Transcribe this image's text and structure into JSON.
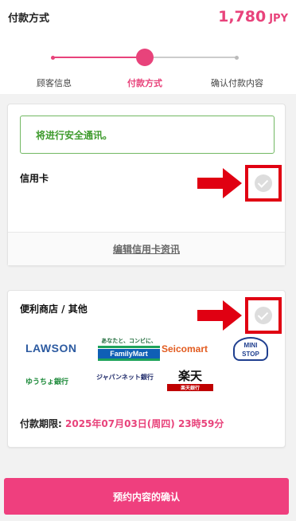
{
  "header": {
    "title": "付款方式",
    "amount": "1,780",
    "currency": "JPY"
  },
  "steps": [
    {
      "label": "顾客信息",
      "state": "done"
    },
    {
      "label": "付款方式",
      "state": "active"
    },
    {
      "label": "确认付款内容",
      "state": "pending"
    }
  ],
  "credit_card": {
    "secure_notice": "将进行安全通讯。",
    "title": "信用卡",
    "edit_link": "编辑信用卡资讯",
    "icon": "check-circle-icon"
  },
  "convenience": {
    "title": "便利商店 / 其他",
    "icon": "check-circle-icon",
    "logos": {
      "lawson": "LAWSON",
      "familymart_tagline": "あなたと、コンビに、",
      "familymart": "FamilyMart",
      "seicomart": "Seicomart",
      "ministop_line1": "MINI",
      "ministop_line2": "STOP",
      "yucho": "ゆうちょ銀行",
      "japannet": "ジャパンネット銀行",
      "rakuten": "楽天",
      "rakuten_sub": "楽天銀行"
    },
    "deadline_label": "付款期限:",
    "deadline_value": "2025年07月03日(周四) 23時59分"
  },
  "confirm_button": "预约内容的确认",
  "colors": {
    "accent": "#e8437b",
    "success": "#3f9b2e",
    "annotation": "#e00012"
  }
}
